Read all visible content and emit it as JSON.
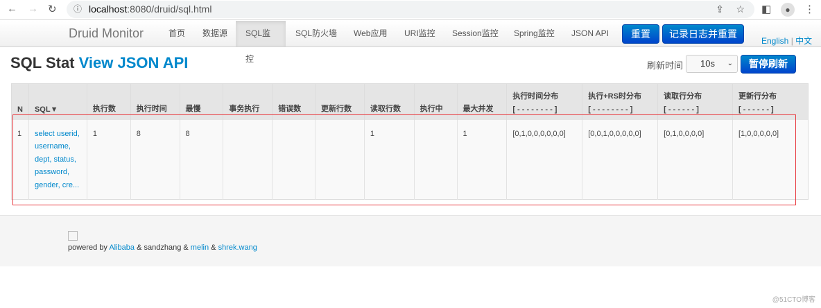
{
  "browser": {
    "host": "localhost",
    "path": ":8080/druid/sql.html"
  },
  "nav": {
    "brand": "Druid Monitor",
    "items": [
      "首页",
      "数据源",
      "SQL监控",
      "SQL防火墙",
      "Web应用",
      "URI监控",
      "Session监控",
      "Spring监控",
      "JSON API"
    ],
    "active": 2,
    "reset": "重置",
    "log_reset": "记录日志并重置",
    "english": "English",
    "sep": "|",
    "chinese": "中文"
  },
  "page": {
    "title": "SQL Stat",
    "link": "View JSON API",
    "refresh_label": "刷新时间",
    "refresh_value": "10s",
    "pause": "暂停刷新"
  },
  "table": {
    "headers": [
      "N",
      "SQL▼",
      "执行数",
      "执行时间",
      "最慢",
      "事务执行",
      "错误数",
      "更新行数",
      "读取行数",
      "执行中",
      "最大并发"
    ],
    "dist_headers": [
      {
        "t": "执行时间分布",
        "s": "[ - - - - - - - - ]"
      },
      {
        "t": "执行+RS时分布",
        "s": "[ - - - - - - - - ]"
      },
      {
        "t": "读取行分布",
        "s": "[ - - - - - - ]"
      },
      {
        "t": "更新行分布",
        "s": "[ - - - - - - ]"
      }
    ],
    "rows": [
      {
        "cells": [
          "1",
          "select userid, username, dept, status, password, gender, cre...",
          "1",
          "8",
          "8",
          "",
          "",
          "",
          "1",
          "",
          "1",
          "[0,1,0,0,0,0,0,0]",
          "[0,0,1,0,0,0,0,0]",
          "[0,1,0,0,0,0]",
          "[1,0,0,0,0,0]"
        ]
      }
    ]
  },
  "footer": {
    "prefix": "powered by",
    "alibaba": "Alibaba",
    "amp1": "&",
    "sandzhang": "sandzhang",
    "amp2": "&",
    "melin": "melin",
    "amp3": "&",
    "shrek": "shrek.wang"
  },
  "watermark": "@51CTO博客"
}
